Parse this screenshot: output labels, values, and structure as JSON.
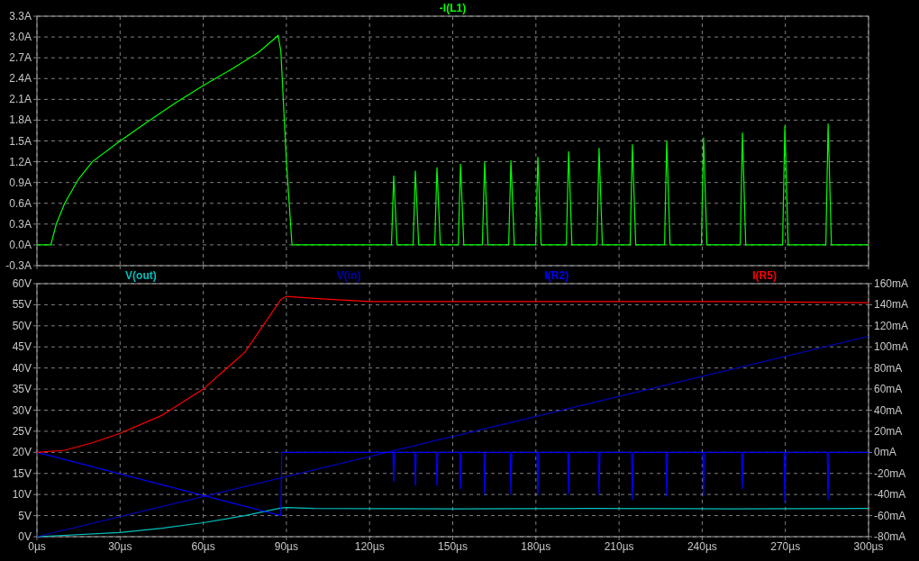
{
  "plots": [
    {
      "chart_data": {
        "type": "line",
        "xlim": [
          0,
          300
        ],
        "ylim": [
          -0.3,
          3.3
        ],
        "grid": true,
        "yticks": [
          {
            "value": 3.3,
            "label": "3.3A"
          },
          {
            "value": 3.0,
            "label": "3.0A"
          },
          {
            "value": 2.7,
            "label": "2.7A"
          },
          {
            "value": 2.4,
            "label": "2.4A"
          },
          {
            "value": 2.1,
            "label": "2.1A"
          },
          {
            "value": 1.8,
            "label": "1.8A"
          },
          {
            "value": 1.5,
            "label": "1.5A"
          },
          {
            "value": 1.2,
            "label": "1.2A"
          },
          {
            "value": 0.9,
            "label": "0.9A"
          },
          {
            "value": 0.6,
            "label": "0.6A"
          },
          {
            "value": 0.3,
            "label": "0.3A"
          },
          {
            "value": 0.0,
            "label": "0.0A"
          },
          {
            "value": -0.3,
            "label": "-0.3A"
          }
        ],
        "x": [
          0,
          5,
          7,
          10,
          15,
          20,
          30,
          40,
          50,
          60,
          70,
          80,
          87,
          88,
          90,
          92,
          127.9,
          128.7,
          129.9,
          135.7,
          136.5,
          137.7,
          143.5,
          144.3,
          145.5,
          152,
          152.8,
          154,
          160.7,
          161.5,
          162.7,
          170.2,
          171,
          172.2,
          179.9,
          180.7,
          181.9,
          191,
          191.8,
          193,
          202,
          202.8,
          204,
          214,
          214.8,
          216,
          226.4,
          227.2,
          228.4,
          239.7,
          240.5,
          241.7,
          253.7,
          254.5,
          255.7,
          269,
          269.8,
          271,
          284.6,
          285.4,
          286.6,
          300
        ],
        "series": [
          {
            "name": "-I(L1)",
            "color": "#00ff00",
            "values": [
              0,
              0,
              0.3,
              0.6,
              0.95,
              1.2,
              1.5,
              1.78,
              2.05,
              2.3,
              2.53,
              2.78,
              3.02,
              2.8,
              1.2,
              0,
              0,
              1.0,
              0,
              0,
              1.07,
              0,
              0,
              1.12,
              0,
              0,
              1.17,
              0,
              0,
              1.2,
              0,
              0,
              1.22,
              0,
              0,
              1.27,
              0,
              0,
              1.35,
              0,
              0,
              1.4,
              0,
              0,
              1.45,
              0,
              0,
              1.5,
              0,
              0,
              1.55,
              0,
              0,
              1.62,
              0,
              0,
              1.72,
              0,
              0,
              1.75,
              0,
              0
            ]
          }
        ]
      }
    },
    {
      "chart_data": {
        "type": "line",
        "xlim": [
          0,
          300
        ],
        "ylim": [
          0,
          60
        ],
        "grid": true,
        "y2lim": [
          -80,
          160
        ],
        "xticks": [
          {
            "value": 0,
            "label": "0µs"
          },
          {
            "value": 30,
            "label": "30µs"
          },
          {
            "value": 60,
            "label": "60µs"
          },
          {
            "value": 90,
            "label": "90µs"
          },
          {
            "value": 120,
            "label": "120µs"
          },
          {
            "value": 150,
            "label": "150µs"
          },
          {
            "value": 180,
            "label": "180µs"
          },
          {
            "value": 210,
            "label": "210µs"
          },
          {
            "value": 240,
            "label": "240µs"
          },
          {
            "value": 270,
            "label": "270µs"
          },
          {
            "value": 300,
            "label": "300µs"
          }
        ],
        "yticks": [
          {
            "value": 60,
            "label": "60V"
          },
          {
            "value": 55,
            "label": "55V"
          },
          {
            "value": 50,
            "label": "50V"
          },
          {
            "value": 45,
            "label": "45V"
          },
          {
            "value": 40,
            "label": "40V"
          },
          {
            "value": 35,
            "label": "35V"
          },
          {
            "value": 30,
            "label": "30V"
          },
          {
            "value": 25,
            "label": "25V"
          },
          {
            "value": 20,
            "label": "20V"
          },
          {
            "value": 15,
            "label": "15V"
          },
          {
            "value": 10,
            "label": "10V"
          },
          {
            "value": 5,
            "label": "5V"
          },
          {
            "value": 0,
            "label": "0V"
          }
        ],
        "y2ticks": [
          {
            "value": 160,
            "label": "160mA"
          },
          {
            "value": 140,
            "label": "140mA"
          },
          {
            "value": 120,
            "label": "120mA"
          },
          {
            "value": 100,
            "label": "100mA"
          },
          {
            "value": 80,
            "label": "80mA"
          },
          {
            "value": 60,
            "label": "60mA"
          },
          {
            "value": 40,
            "label": "40mA"
          },
          {
            "value": 20,
            "label": "20mA"
          },
          {
            "value": 0,
            "label": "0mA"
          },
          {
            "value": -20,
            "label": "-20mA"
          },
          {
            "value": -40,
            "label": "-40mA"
          },
          {
            "value": -60,
            "label": "-60mA"
          },
          {
            "value": -80,
            "label": "-80mA"
          }
        ],
        "series": [
          {
            "name": "V(out)",
            "color": "#00c0c0",
            "x": [
              0,
              30,
              45,
              60,
              75,
              88,
              90,
              100,
              150,
              200,
              250,
              300
            ],
            "values": [
              0,
              1.0,
              2.0,
              3.3,
              5.0,
              6.8,
              6.9,
              6.7,
              6.6,
              6.7,
              6.6,
              6.7
            ]
          },
          {
            "name": "V(in)",
            "color": "#0000c0",
            "x": [
              0,
              300
            ],
            "values": [
              0,
              47.5
            ]
          },
          {
            "name": "I(R2)",
            "color": "#0000ff",
            "axis": "y2",
            "x": [
              0,
              88,
              88.3,
              128.4,
              128.7,
              129,
              136.2,
              136.5,
              136.8,
              144,
              144.3,
              144.6,
              152.5,
              152.8,
              153.1,
              161.2,
              161.5,
              161.8,
              170.7,
              171,
              171.3,
              180.4,
              180.7,
              181,
              191.5,
              191.8,
              192.1,
              202.5,
              202.8,
              203.1,
              214.5,
              214.8,
              215.1,
              226.9,
              227.2,
              227.5,
              240.2,
              240.5,
              240.8,
              254.2,
              254.5,
              254.8,
              269.5,
              269.8,
              270.1,
              285.1,
              285.4,
              285.7,
              300
            ],
            "values": [
              0,
              -60,
              0,
              0,
              -28,
              0,
              0,
              -32,
              0,
              0,
              -32,
              0,
              0,
              -35,
              0,
              0,
              -40,
              0,
              0,
              -40,
              0,
              0,
              -40,
              0,
              0,
              -40,
              0,
              0,
              -40,
              0,
              0,
              -45,
              0,
              0,
              -42,
              0,
              0,
              -42,
              0,
              0,
              -35,
              0,
              0,
              -48,
              0,
              0,
              -45,
              0,
              0
            ]
          },
          {
            "name": "I(R5)",
            "color": "#ff0000",
            "axis": "y2",
            "x": [
              0,
              10,
              20,
              30,
              45,
              60,
              75,
              88,
              90,
              100,
              120,
              150,
              200,
              250,
              300
            ],
            "values": [
              0,
              2,
              9,
              18,
              35,
              60,
              95,
              145,
              148,
              146,
              143,
              143,
              143,
              143,
              142
            ]
          }
        ]
      }
    }
  ]
}
